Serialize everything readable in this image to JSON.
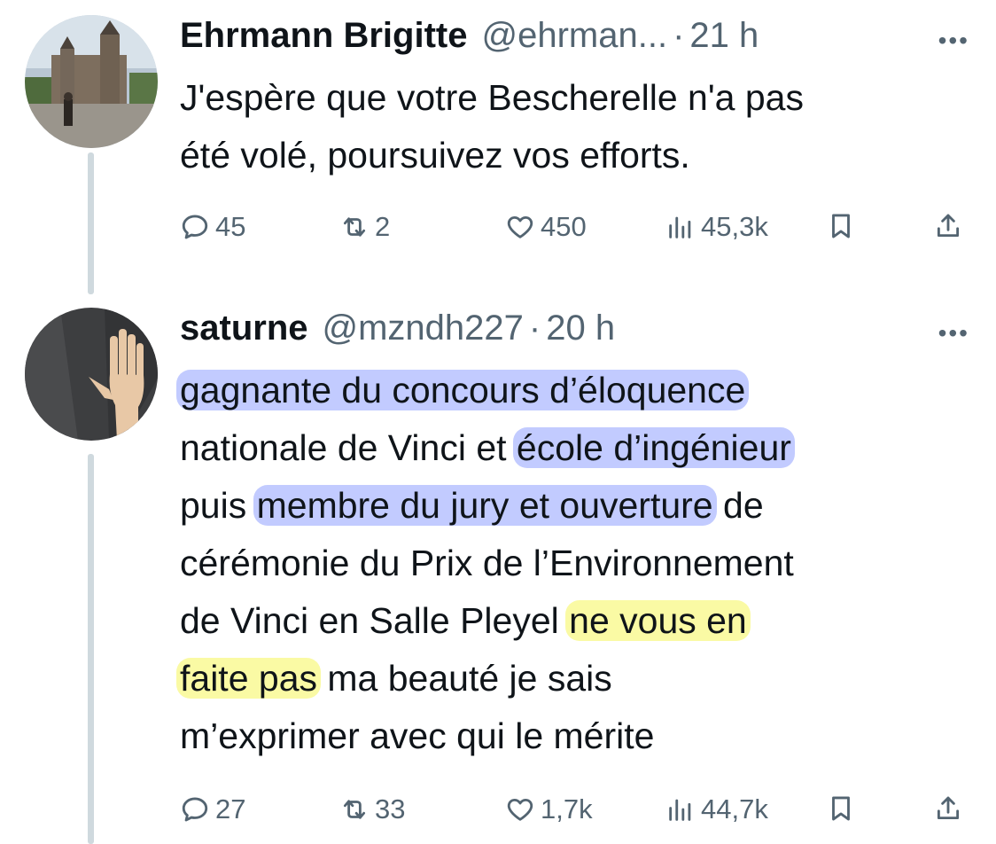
{
  "tweets": [
    {
      "author_name": "Ehrmann Brigitte",
      "handle": "@ehrman...",
      "dot": "·",
      "time": "21 h",
      "more": "•••",
      "text_lines": [
        "J'espère que votre Bescherelle n'a pas",
        "été volé, poursuivez vos efforts."
      ],
      "replies": "45",
      "retweets": "2",
      "likes": "450",
      "views": "45,3k"
    },
    {
      "author_name": "saturne",
      "handle": "@mzndh227",
      "dot": "·",
      "time": "20 h",
      "more": "•••",
      "segments": {
        "l1": "gagnante du concours d’éloquence",
        "l2a": "nationale de Vinci et ",
        "l2b": "école d’ingénieur",
        "l3a": "puis ",
        "l3b": "membre du jury et ouverture",
        "l3c": " de",
        "l4": "cérémonie du Prix de l’Environnement",
        "l5a": "de Vinci en Salle Pleyel ",
        "l5b": "ne vous en",
        "l6a": "faite pas",
        "l6b": " ma beauté je sais",
        "l7": "m’exprimer avec qui le mérite"
      },
      "replies": "27",
      "retweets": "33",
      "likes": "1,7k",
      "views": "44,7k"
    }
  ],
  "icons": [
    "reply-icon",
    "retweet-icon",
    "like-icon",
    "views-icon",
    "bookmark-icon",
    "share-icon"
  ],
  "colors": {
    "blue_highlight": "#788cff",
    "yellow_highlight": "#f5f55a",
    "muted": "#536471"
  }
}
